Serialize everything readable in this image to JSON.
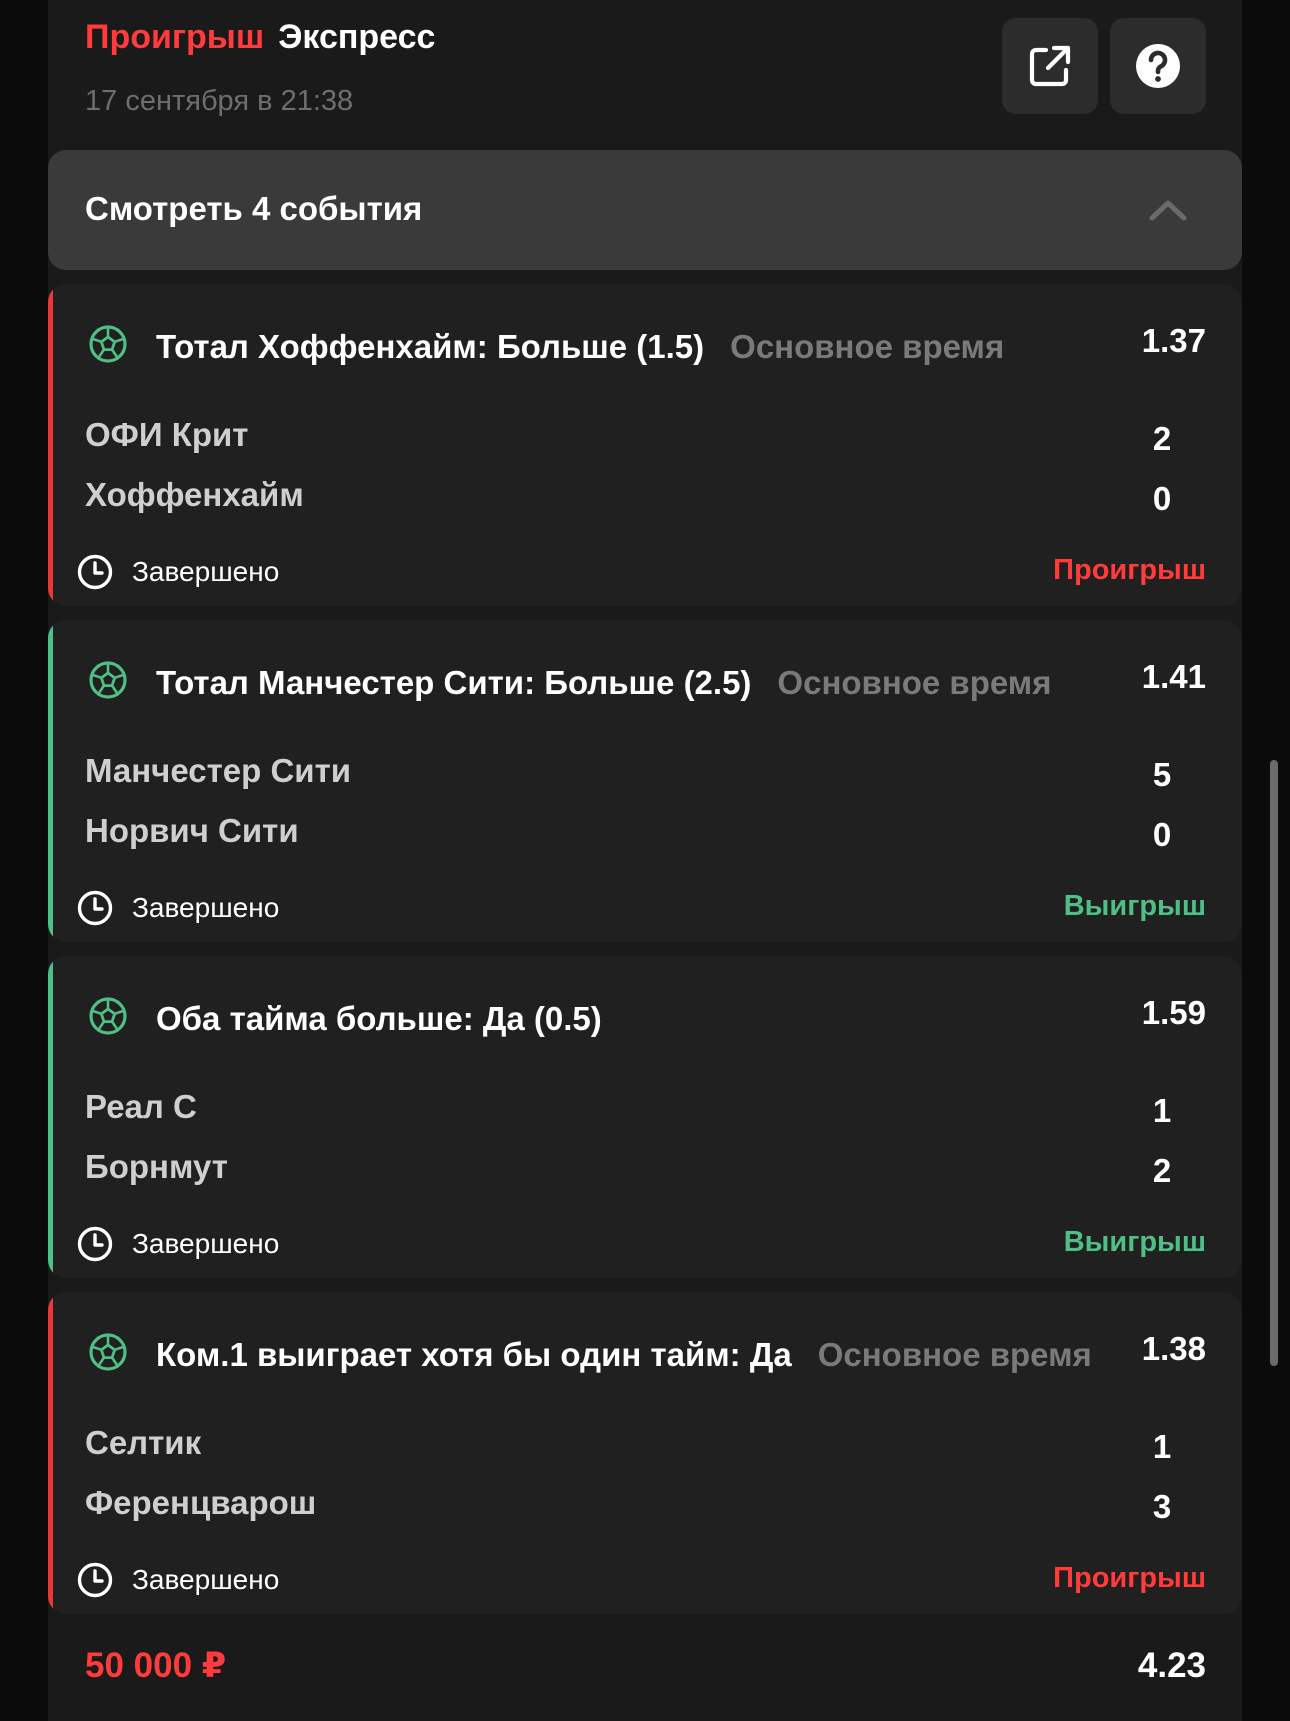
{
  "header": {
    "status": "Проигрыш",
    "bet_type": "Экспресс",
    "date": "17 сентября в 21:38",
    "share_icon": "share-external-icon",
    "help_icon": "help-circle-icon"
  },
  "toggle": {
    "label": "Смотреть 4 события",
    "icon": "chevron-up-icon"
  },
  "events": [
    {
      "market": "Тотал Хоффенхайм: Больше (1.5)",
      "period": "Основное время",
      "odds": "1.37",
      "team1": "ОФИ Крит",
      "score1": "2",
      "team2": "Хоффенхайм",
      "score2": "0",
      "state": "Завершено",
      "outcome": "Проигрыш",
      "result": "loss"
    },
    {
      "market": "Тотал Манчестер Сити: Больше (2.5)",
      "period": "Основное время",
      "odds": "1.41",
      "team1": "Манчестер Сити",
      "score1": "5",
      "team2": "Норвич Сити",
      "score2": "0",
      "state": "Завершено",
      "outcome": "Выигрыш",
      "result": "win"
    },
    {
      "market": "Оба тайма больше: Да (0.5)",
      "period": "",
      "odds": "1.59",
      "team1": "Реал С",
      "score1": "1",
      "team2": "Борнмут",
      "score2": "2",
      "state": "Завершено",
      "outcome": "Выигрыш",
      "result": "win"
    },
    {
      "market": "Ком.1 выиграет хотя бы один тайм: Да",
      "period": "Основное время",
      "odds": "1.38",
      "team1": "Селтик",
      "score1": "1",
      "team2": "Ференцварош",
      "score2": "3",
      "state": "Завершено",
      "outcome": "Проигрыш",
      "result": "loss"
    }
  ],
  "footer": {
    "stake": "50 000 ₽",
    "total_odds": "4.23"
  },
  "colors": {
    "loss": "#ff3b3b",
    "win": "#4fbf86",
    "background": "#1a1a1a",
    "card": "#202020"
  }
}
